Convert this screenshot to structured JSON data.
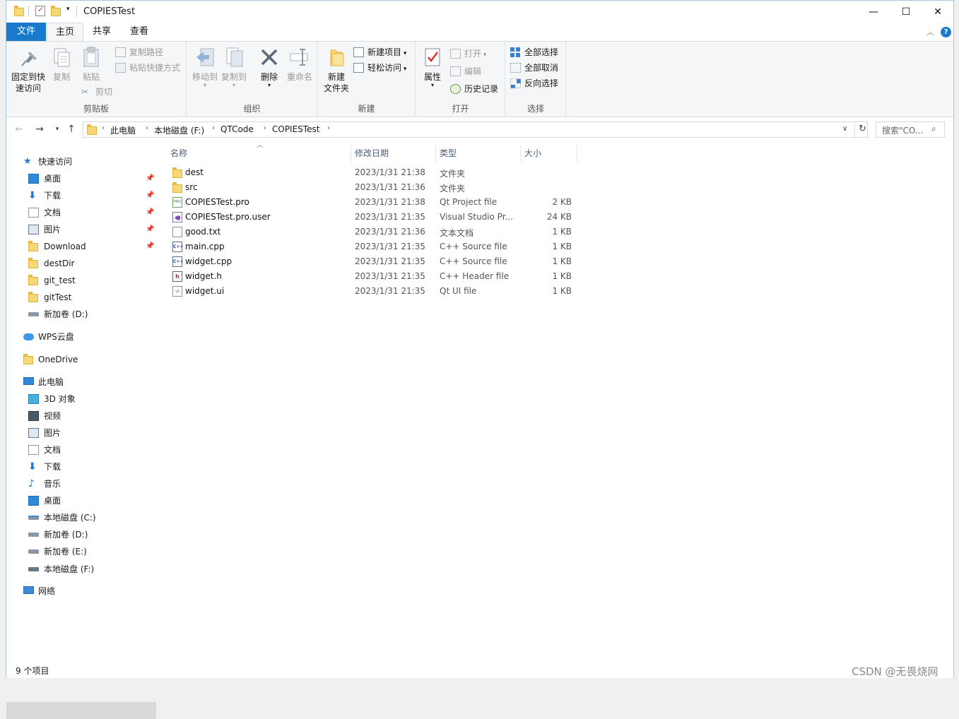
{
  "window": {
    "title": "COPIESTest"
  },
  "tabs": {
    "file": "文件",
    "home": "主页",
    "share": "共享",
    "view": "查看"
  },
  "ribbon": {
    "clipboard": {
      "label": "剪贴板",
      "pin_quick_access": "固定到快\n速访问",
      "pin_line1": "固定到快",
      "pin_line2": "速访问",
      "copy": "复制",
      "paste": "粘贴",
      "copy_path": "复制路径",
      "paste_shortcut": "粘贴快捷方式",
      "cut": "剪切"
    },
    "organize": {
      "label": "组织",
      "move_to": "移动到",
      "copy_to": "复制到",
      "delete": "删除",
      "rename": "重命名"
    },
    "new": {
      "label": "新建",
      "new_folder_line1": "新建",
      "new_folder_line2": "文件夹",
      "new_item": "新建项目",
      "easy_access": "轻松访问"
    },
    "open": {
      "label": "打开",
      "properties": "属性",
      "open": "打开",
      "edit": "编辑",
      "history": "历史记录"
    },
    "select": {
      "label": "选择",
      "select_all": "全部选择",
      "select_none": "全部取消",
      "invert": "反向选择"
    }
  },
  "address": {
    "crumbs": [
      "此电脑",
      "本地磁盘 (F:)",
      "QTCode",
      "COPIESTest"
    ],
    "search_placeholder": "搜索\"CO..."
  },
  "nav": {
    "quick_access": "快速访问",
    "quick_items": [
      "桌面",
      "下载",
      "文档",
      "图片",
      "Download",
      "destDir",
      "git_test",
      "gitTest",
      "新加卷 (D:)"
    ],
    "wps": "WPS云盘",
    "onedrive": "OneDrive",
    "this_pc": "此电脑",
    "pc_items": [
      "3D 对象",
      "视频",
      "图片",
      "文档",
      "下载",
      "音乐",
      "桌面",
      "本地磁盘 (C:)",
      "新加卷 (D:)",
      "新加卷 (E:)",
      "本地磁盘 (F:)"
    ],
    "network": "网络"
  },
  "columns": {
    "name": "名称",
    "date": "修改日期",
    "type": "类型",
    "size": "大小"
  },
  "files": [
    {
      "name": "dest",
      "date": "2023/1/31 21:38",
      "type": "文件夹",
      "size": ""
    },
    {
      "name": "src",
      "date": "2023/1/31 21:36",
      "type": "文件夹",
      "size": ""
    },
    {
      "name": "COPIESTest.pro",
      "date": "2023/1/31 21:38",
      "type": "Qt Project file",
      "size": "2 KB"
    },
    {
      "name": "COPIESTest.pro.user",
      "date": "2023/1/31 21:35",
      "type": "Visual Studio Pr...",
      "size": "24 KB"
    },
    {
      "name": "good.txt",
      "date": "2023/1/31 21:36",
      "type": "文本文档",
      "size": "1 KB"
    },
    {
      "name": "main.cpp",
      "date": "2023/1/31 21:35",
      "type": "C++ Source file",
      "size": "1 KB"
    },
    {
      "name": "widget.cpp",
      "date": "2023/1/31 21:35",
      "type": "C++ Source file",
      "size": "1 KB"
    },
    {
      "name": "widget.h",
      "date": "2023/1/31 21:35",
      "type": "C++ Header file",
      "size": "1 KB"
    },
    {
      "name": "widget.ui",
      "date": "2023/1/31 21:35",
      "type": "Qt UI file",
      "size": "1 KB"
    }
  ],
  "status": {
    "count": "9 个项目"
  },
  "watermark": "CSDN @无畏烧网"
}
